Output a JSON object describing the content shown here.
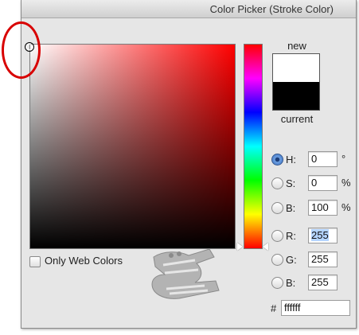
{
  "window": {
    "title": "Color Picker (Stroke Color)"
  },
  "swatch": {
    "new_label": "new",
    "current_label": "current",
    "new_color": "#ffffff",
    "current_color": "#000000"
  },
  "fields": {
    "H": {
      "label": "H:",
      "value": "0",
      "unit": "°",
      "selected": true
    },
    "S": {
      "label": "S:",
      "value": "0",
      "unit": "%"
    },
    "B": {
      "label": "B:",
      "value": "100",
      "unit": "%"
    },
    "R": {
      "label": "R:",
      "value": "255"
    },
    "G": {
      "label": "G:",
      "value": "255"
    },
    "Bl": {
      "label": "B:",
      "value": "255"
    }
  },
  "hex": {
    "label": "#",
    "value": "ffffff"
  },
  "web_colors": {
    "label": "Only Web Colors",
    "checked": false
  },
  "colors": {
    "annotation_circle": "#d80000",
    "field_hue": "#ff0000"
  }
}
